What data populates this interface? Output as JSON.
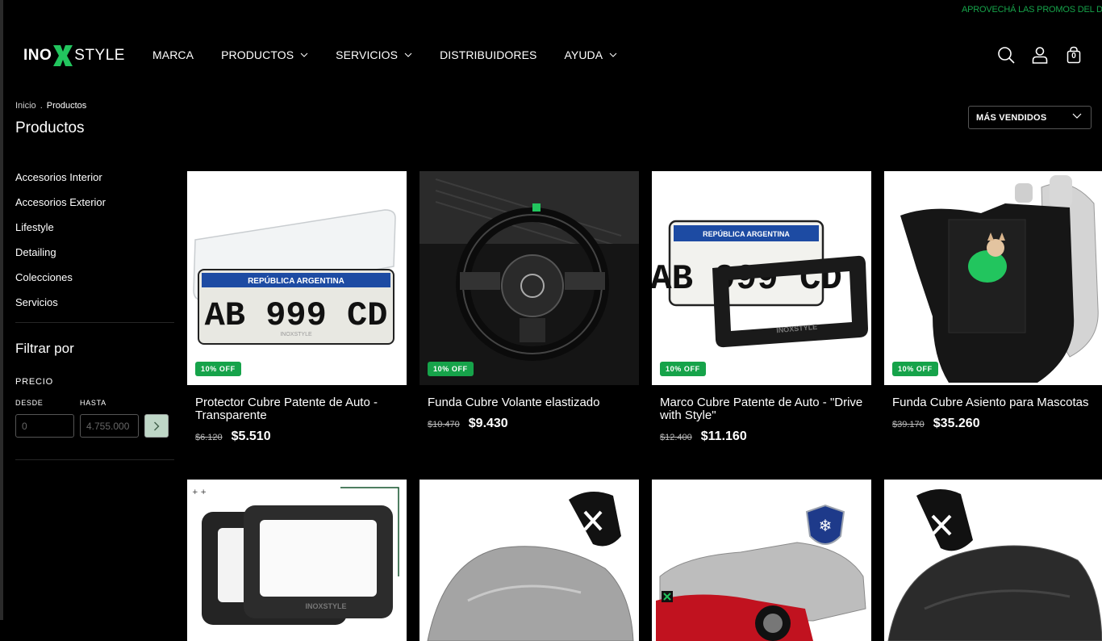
{
  "promo_text": "APROVECHÁ LAS PROMOS DEL DIA",
  "logo": {
    "left": "INO",
    "right": "STYLE"
  },
  "nav": [
    {
      "label": "MARCA",
      "dropdown": false
    },
    {
      "label": "PRODUCTOS",
      "dropdown": true
    },
    {
      "label": "SERVICIOS",
      "dropdown": true
    },
    {
      "label": "DISTRIBUIDORES",
      "dropdown": false
    },
    {
      "label": "AYUDA",
      "dropdown": true
    }
  ],
  "cart_count": "0",
  "breadcrumb": {
    "home": "Inicio",
    "sep": ".",
    "current": "Productos"
  },
  "page_title": "Productos",
  "sort": {
    "selected": "MÁS VENDIDOS"
  },
  "sidebar": {
    "categories": [
      "Accesorios Interior",
      "Accesorios Exterior",
      "Lifestyle",
      "Detailing",
      "Colecciones",
      "Servicios"
    ],
    "filter_title": "Filtrar por",
    "price_label": "PRECIO",
    "from_label": "DESDE",
    "to_label": "HASTA",
    "from_placeholder": "0",
    "to_placeholder": "4.755.000"
  },
  "products": [
    {
      "name": "Protector Cubre Patente de Auto - Transparente",
      "old_price": "$6.120",
      "price": "$5.510",
      "badge": "10% OFF"
    },
    {
      "name": "Funda Cubre Volante elastizado",
      "old_price": "$10.470",
      "price": "$9.430",
      "badge": "10% OFF"
    },
    {
      "name": "Marco Cubre Patente de Auto - \"Drive with Style\"",
      "old_price": "$12.400",
      "price": "$11.160",
      "badge": "10% OFF"
    },
    {
      "name": "Funda Cubre Asiento para Mascotas",
      "old_price": "$39.170",
      "price": "$35.260",
      "badge": "10% OFF"
    }
  ],
  "plate": {
    "country": "REPÚBLICA ARGENTINA",
    "number": "AB 999 CD",
    "brand": "INOXSTYLE"
  },
  "colors": {
    "accent": "#16a34a",
    "background": "#000000",
    "text": "#ffffff"
  },
  "icons": [
    "search-icon",
    "user-icon",
    "cart-icon"
  ]
}
